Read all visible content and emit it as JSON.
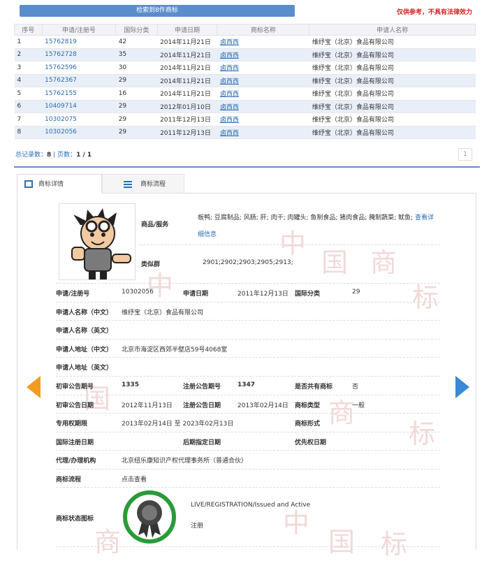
{
  "header": {
    "search_result": "检索到8件商标",
    "disclaimer": "仅供参考，不具有法律效力"
  },
  "table": {
    "columns": [
      "序号",
      "申请/注册号",
      "国际分类",
      "申请日期",
      "商标名称",
      "申请人名称"
    ],
    "rows": [
      [
        "1",
        "15762819",
        "42",
        "2014年11月21日",
        "卤西西",
        "维纾宝（北京）食品有限公司"
      ],
      [
        "2",
        "15762728",
        "35",
        "2014年11月21日",
        "卤西西",
        "维纾宝（北京）食品有限公司"
      ],
      [
        "3",
        "15762596",
        "30",
        "2014年11月21日",
        "卤西西",
        "维纾宝（北京）食品有限公司"
      ],
      [
        "4",
        "15762367",
        "29",
        "2014年11月21日",
        "卤西西",
        "维纾宝（北京）食品有限公司"
      ],
      [
        "5",
        "15762155",
        "16",
        "2014年11月21日",
        "卤西西",
        "维纾宝（北京）食品有限公司"
      ],
      [
        "6",
        "10409714",
        "29",
        "2012年01月10日",
        "卤西西",
        "维纾宝（北京）食品有限公司"
      ],
      [
        "7",
        "10302075",
        "29",
        "2011年12月13日",
        "卤西西",
        "维纾宝（北京）食品有限公司"
      ],
      [
        "8",
        "10302056",
        "29",
        "2011年12月13日",
        "卤西西",
        "维纾宝（北京）食品有限公司"
      ]
    ]
  },
  "pager": {
    "total_label": "总记录数：",
    "total": "8",
    "sep": " | ",
    "pages_label": "页数：",
    "pages": "1 / 1",
    "page_btn": "1"
  },
  "tabs": {
    "detail": "商标详情",
    "flow": "商标流程"
  },
  "watermark": [
    "中",
    "国",
    "商",
    "标"
  ],
  "detail": {
    "goods_label": "商品/服务",
    "goods_value": "板鸭; 豆腐制品; 风肠; 肝; 肉干; 肉罐头; 鱼制食品; 猪肉食品; 腌制蔬菜; 鱿鱼;",
    "goods_more": "查看详细信息",
    "similar_label": "类似群",
    "similar_value": "2901;2902;2903;2905;2913;",
    "reg_no_label": "申请/注册号",
    "reg_no": "10302056",
    "apply_date_label": "申请日期",
    "apply_date": "2011年12月13日",
    "intl_class_label": "国际分类",
    "intl_class": "29",
    "applicant_cn_label": "申请人名称（中文）",
    "applicant_cn": "维纾宝（北京）食品有限公司",
    "applicant_en_label": "申请人名称（英文）",
    "addr_cn_label": "申请人地址（中文）",
    "addr_cn": "北京市海淀区西郊半壁店59号4068室",
    "addr_en_label": "申请人地址（英文）",
    "prelim_no_label": "初审公告期号",
    "prelim_no": "1335",
    "reg_pub_no_label": "注册公告期号",
    "reg_pub_no": "1347",
    "shared_label": "是否共有商标",
    "shared": "否",
    "prelim_date_label": "初审公告日期",
    "prelim_date": "2012年11月13日",
    "reg_pub_date_label": "注册公告日期",
    "reg_pub_date": "2013年02月14日",
    "mark_type_label": "商标类型",
    "mark_type": "一般",
    "excl_label": "专用权期限",
    "excl": "2013年02月14日 至 2023年02月13日",
    "mark_form_label": "商标形式",
    "intl_reg_label": "国际注册日期",
    "later_label": "后期指定日期",
    "priority_label": "优先权日期",
    "agent_label": "代理/办理机构",
    "agent": "北京纽乐康知识产权代理事务所（普通合伙）",
    "flow_label": "商标流程",
    "flow_link": "点击查看",
    "status_label": "商标状态图标",
    "status_en": "LIVE/REGISTRATION/Issued and Active",
    "status_cn": "注册"
  }
}
